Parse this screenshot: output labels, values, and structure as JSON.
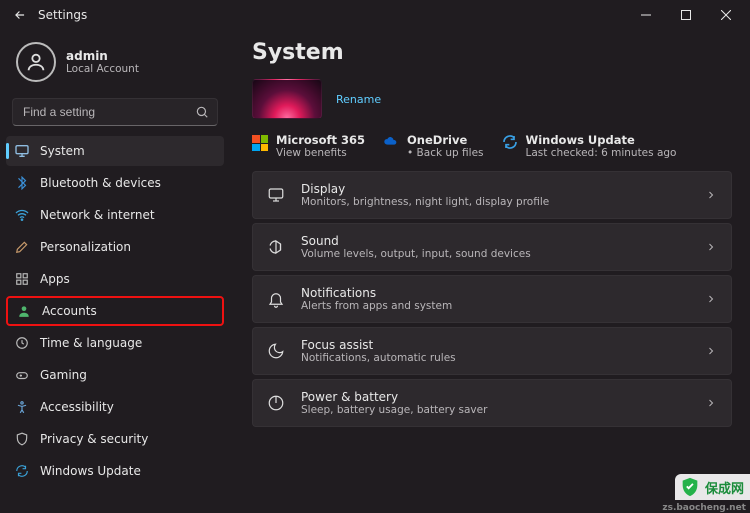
{
  "titlebar": {
    "title": "Settings"
  },
  "user": {
    "name": "admin",
    "sub": "Local Account"
  },
  "search": {
    "placeholder": "Find a setting"
  },
  "nav": [
    {
      "label": "System",
      "icon": "system",
      "active": true
    },
    {
      "label": "Bluetooth & devices",
      "icon": "bluetooth",
      "active": false
    },
    {
      "label": "Network & internet",
      "icon": "network",
      "active": false
    },
    {
      "label": "Personalization",
      "icon": "personalization",
      "active": false
    },
    {
      "label": "Apps",
      "icon": "apps",
      "active": false
    },
    {
      "label": "Accounts",
      "icon": "accounts",
      "active": false,
      "highlight": true
    },
    {
      "label": "Time & language",
      "icon": "time",
      "active": false
    },
    {
      "label": "Gaming",
      "icon": "gaming",
      "active": false
    },
    {
      "label": "Accessibility",
      "icon": "accessibility",
      "active": false
    },
    {
      "label": "Privacy & security",
      "icon": "privacy",
      "active": false
    },
    {
      "label": "Windows Update",
      "icon": "update",
      "active": false
    }
  ],
  "page": {
    "heading": "System",
    "rename": "Rename",
    "ms365": {
      "title": "Microsoft 365",
      "sub": "View benefits"
    },
    "onedrive": {
      "title": "OneDrive",
      "sub": "• Back up files"
    },
    "update": {
      "title": "Windows Update",
      "sub": "Last checked: 6 minutes ago"
    },
    "cards": [
      {
        "title": "Display",
        "sub": "Monitors, brightness, night light, display profile"
      },
      {
        "title": "Sound",
        "sub": "Volume levels, output, input, sound devices"
      },
      {
        "title": "Notifications",
        "sub": "Alerts from apps and system"
      },
      {
        "title": "Focus assist",
        "sub": "Notifications, automatic rules"
      },
      {
        "title": "Power & battery",
        "sub": "Sleep, battery usage, battery saver"
      }
    ]
  },
  "watermark": {
    "text": "保成网",
    "url": "zs.baocheng.net"
  }
}
